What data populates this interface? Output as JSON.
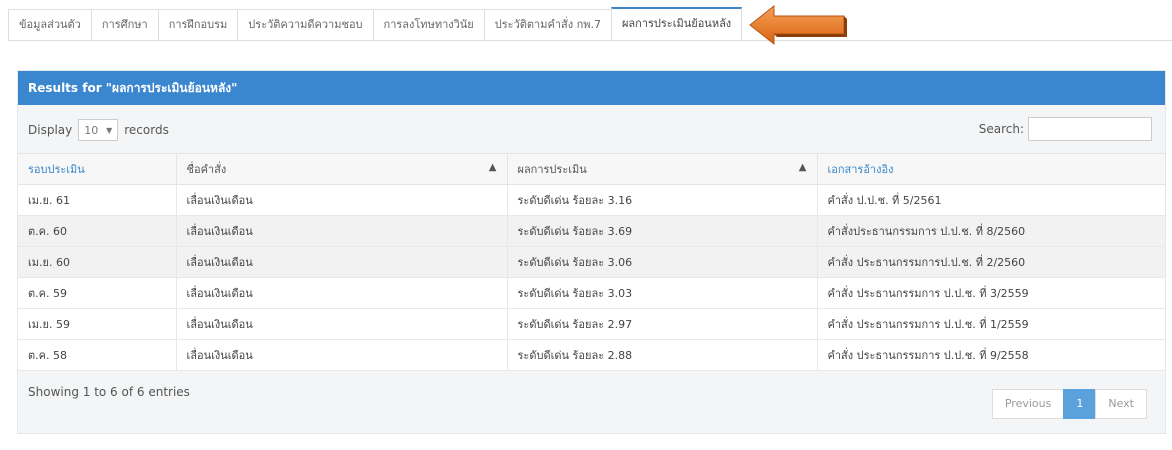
{
  "tabs": [
    {
      "label": "ข้อมูลส่วนตัว"
    },
    {
      "label": "การศึกษา"
    },
    {
      "label": "การฝึกอบรม"
    },
    {
      "label": "ประวัติความดีความชอบ"
    },
    {
      "label": "การลงโทษทางวินัย"
    },
    {
      "label": "ประวัติตามคำสั่ง กพ.7"
    },
    {
      "label": "ผลการประเมินย้อนหลัง"
    }
  ],
  "panel": {
    "title": "Results for \"ผลการประเมินย้อนหลัง\""
  },
  "controls": {
    "display_label": "Display",
    "page_size": "10",
    "records_label": "records",
    "search_label": "Search:",
    "search_value": ""
  },
  "table": {
    "headers": [
      "รอบประเมิน",
      "ชื่อคำสั่ง",
      "ผลการประเมิน",
      "เอกสารอ้างอิง"
    ],
    "rows": [
      [
        "เม.ย. 61",
        "เลื่อนเงินเดือน",
        "ระดับดีเด่น ร้อยละ 3.16",
        "คำสั่ง ป.ป.ช. ที่ 5/2561"
      ],
      [
        "ต.ค. 60",
        "เลื่อนเงินเดือน",
        "ระดับดีเด่น ร้อยละ 3.69",
        "คำสั่งประธานกรรมการ ป.ป.ช. ที่ 8/2560"
      ],
      [
        "เม.ย. 60",
        "เลื่อนเงินเดือน",
        "ระดับดีเด่น ร้อยละ 3.06",
        "คำสั่ง ประธานกรรมการป.ป.ช. ที่ 2/2560"
      ],
      [
        "ต.ค. 59",
        "เลื่อนเงินเดือน",
        "ระดับดีเด่น ร้อยละ 3.03",
        "คำสั่ง ประธานกรรมการ ป.ป.ช. ที่ 3/2559"
      ],
      [
        "เม.ย. 59",
        "เลื่อนเงินเดือน",
        "ระดับดีเด่น ร้อยละ 2.97",
        "คำสั่ง ประธานกรรมการ ป.ป.ช. ที่ 1/2559"
      ],
      [
        "ต.ค. 58",
        "เลื่อนเงินเดือน",
        "ระดับดีเด่น ร้อยละ 2.88",
        "คำสั่ง ประธานกรรมการ ป.ป.ช. ที่ 9/2558"
      ]
    ]
  },
  "footer": {
    "info": "Showing 1 to 6 of 6 entries",
    "prev_label": "Previous",
    "current_page": "1",
    "next_label": "Next"
  },
  "colors": {
    "accent": "#3b87cf",
    "arrow": "#e8731c"
  },
  "icons": {
    "arrow": "arrow-left-icon",
    "sort": "sort-icon",
    "dropdown": "caret-down-icon"
  }
}
